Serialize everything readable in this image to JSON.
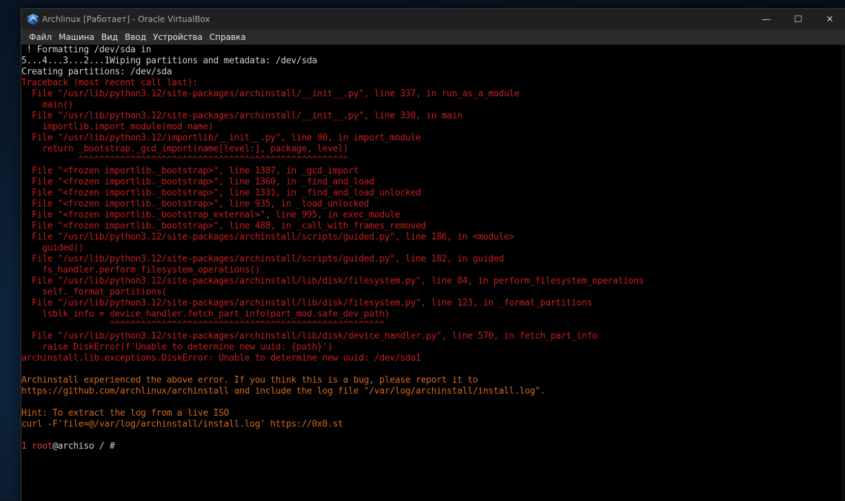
{
  "window": {
    "title": "Archlinux [Работает] - Oracle VirtualBox",
    "controls": [
      "—",
      "☐",
      "✕"
    ]
  },
  "menu": [
    "Файл",
    "Машина",
    "Вид",
    "Ввод",
    "Устройства",
    "Справка"
  ],
  "terminal": {
    "lines": [
      {
        "t": " ! Formatting /dev/sda in",
        "c": "white"
      },
      {
        "t": "5...4...3...2...1Wiping partitions and metadata: /dev/sda",
        "c": "white"
      },
      {
        "t": "Creating partitions: /dev/sda",
        "c": "white"
      },
      {
        "t": "Traceback (most recent call last):",
        "c": "red"
      },
      {
        "t": "  File \"/usr/lib/python3.12/site-packages/archinstall/__init__.py\", line 337, in run_as_a_module",
        "c": "red"
      },
      {
        "t": "    main()",
        "c": "red"
      },
      {
        "t": "  File \"/usr/lib/python3.12/site-packages/archinstall/__init__.py\", line 330, in main",
        "c": "red"
      },
      {
        "t": "    importlib.import_module(mod_name)",
        "c": "red"
      },
      {
        "t": "  File \"/usr/lib/python3.12/importlib/__init__.py\", line 90, in import_module",
        "c": "red"
      },
      {
        "t": "    return _bootstrap._gcd_import(name[level:], package, level)",
        "c": "red"
      },
      {
        "t": "           ^^^^^^^^^^^^^^^^^^^^^^^^^^^^^^^^^^^^^^^^^^^^^^^^^^^^",
        "c": "red"
      },
      {
        "t": "  File \"<frozen importlib._bootstrap>\", line 1387, in _gcd_import",
        "c": "red"
      },
      {
        "t": "  File \"<frozen importlib._bootstrap>\", line 1360, in _find_and_load",
        "c": "red"
      },
      {
        "t": "  File \"<frozen importlib._bootstrap>\", line 1331, in _find_and_load_unlocked",
        "c": "red"
      },
      {
        "t": "  File \"<frozen importlib._bootstrap>\", line 935, in _load_unlocked",
        "c": "red"
      },
      {
        "t": "  File \"<frozen importlib._bootstrap_external>\", line 995, in exec_module",
        "c": "red"
      },
      {
        "t": "  File \"<frozen importlib._bootstrap>\", line 488, in _call_with_frames_removed",
        "c": "red"
      },
      {
        "t": "  File \"/usr/lib/python3.12/site-packages/archinstall/scripts/guided.py\", line 186, in <module>",
        "c": "red"
      },
      {
        "t": "    guided()",
        "c": "red"
      },
      {
        "t": "  File \"/usr/lib/python3.12/site-packages/archinstall/scripts/guided.py\", line 182, in guided",
        "c": "red"
      },
      {
        "t": "    fs_handler.perform_filesystem_operations()",
        "c": "red"
      },
      {
        "t": "  File \"/usr/lib/python3.12/site-packages/archinstall/lib/disk/filesystem.py\", line 84, in perform_filesystem_operations",
        "c": "red"
      },
      {
        "t": "    self._format_partitions(",
        "c": "red"
      },
      {
        "t": "  File \"/usr/lib/python3.12/site-packages/archinstall/lib/disk/filesystem.py\", line 123, in _format_partitions",
        "c": "red"
      },
      {
        "t": "    lsblk_info = device_handler.fetch_part_info(part_mod.safe_dev_path)",
        "c": "red"
      },
      {
        "t": "                 ^^^^^^^^^^^^^^^^^^^^^^^^^^^^^^^^^^^^^^^^^^^^^^^^^^^^^",
        "c": "red"
      },
      {
        "t": "  File \"/usr/lib/python3.12/site-packages/archinstall/lib/disk/device_handler.py\", line 570, in fetch_part_info",
        "c": "red"
      },
      {
        "t": "    raise DiskError(f'Unable to determine new uuid: {path}')",
        "c": "red"
      },
      {
        "t": "archinstall.lib.exceptions.DiskError: Unable to determine new uuid: /dev/sda1",
        "c": "red"
      },
      {
        "t": "",
        "c": "white"
      },
      {
        "t": "Archinstall experienced the above error. If you think this is a bug, please report it to",
        "c": "orange"
      },
      {
        "t": "https://github.com/archlinux/archinstall and include the log file \"/var/log/archinstall/install.log\".",
        "c": "orange"
      },
      {
        "t": "",
        "c": "white"
      },
      {
        "t": "Hint: To extract the log from a live ISO",
        "c": "orange"
      },
      {
        "t": "curl -F'file=@/var/log/archinstall/install.log' https://0x0.st",
        "c": "orange"
      },
      {
        "t": "",
        "c": "white"
      }
    ],
    "prompt": {
      "num": "1",
      "user": "root",
      "rest": "@archiso / # "
    }
  },
  "colors": {
    "red": "#c81e1e",
    "orange": "#d2691e",
    "white": "#d0d0d0"
  }
}
